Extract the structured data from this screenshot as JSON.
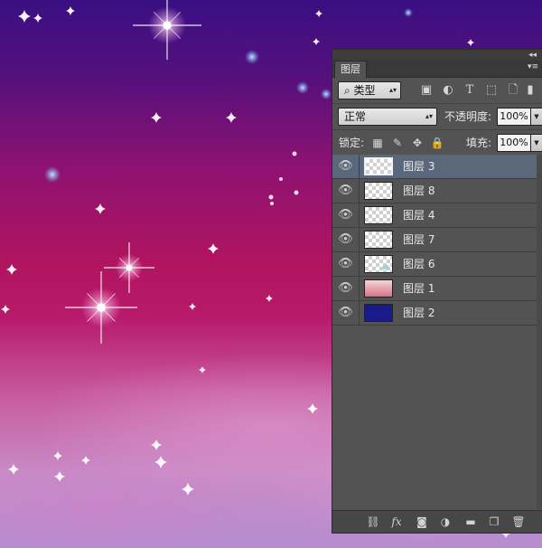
{
  "panel": {
    "tab_label": "图层",
    "collapse_icon": "double-chevron-left",
    "menu_icon": "panel-menu"
  },
  "filter": {
    "kind_label": "类型",
    "icons": [
      "image-filter-icon",
      "adjustment-filter-icon",
      "type-filter-icon",
      "shape-filter-icon",
      "smart-object-filter-icon"
    ]
  },
  "blend": {
    "mode": "正常",
    "opacity_label": "不透明度:",
    "opacity_value": "100%"
  },
  "lock": {
    "label": "锁定:",
    "fill_label": "填充:",
    "fill_value": "100%"
  },
  "layers": [
    {
      "name": "图层 3",
      "selected": true,
      "thumb": "transparent"
    },
    {
      "name": "图层 8",
      "selected": false,
      "thumb": "transparent"
    },
    {
      "name": "图层 4",
      "selected": false,
      "thumb": "transparent"
    },
    {
      "name": "图层 7",
      "selected": false,
      "thumb": "transparent"
    },
    {
      "name": "图层 6",
      "selected": false,
      "thumb": "sparkle"
    },
    {
      "name": "图层 1",
      "selected": false,
      "thumb": "pink"
    },
    {
      "name": "图层 2",
      "selected": false,
      "thumb": "blue"
    }
  ],
  "colors": {
    "panel_bg": "#535353",
    "selected_row": "#5b677a",
    "canvas_top": "#3a0f82",
    "canvas_mid": "#b0145f",
    "canvas_bottom": "#b58dcf"
  },
  "bottom_icons": [
    "link-icon",
    "fx-icon",
    "mask-icon",
    "adjustment-icon",
    "folder-icon",
    "new-layer-icon",
    "trash-icon"
  ]
}
